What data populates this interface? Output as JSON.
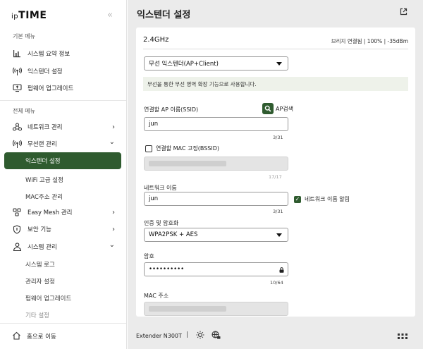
{
  "brand": {
    "logo_prefix": "ip",
    "logo_main": "TIME"
  },
  "sidebar": {
    "basic_section": "기본 메뉴",
    "basic_items": [
      {
        "label": "시스템 요약 정보",
        "icon": "bar-chart-icon"
      },
      {
        "label": "익스텐더 설정",
        "icon": "wifi-signal-icon"
      },
      {
        "label": "펌웨어 업그레이드",
        "icon": "monitor-upload-icon"
      }
    ],
    "full_section": "전체 메뉴",
    "full_items": [
      {
        "label": "네트워크 관리",
        "icon": "network-icon",
        "chevron": "›"
      },
      {
        "label": "무선랜 관리",
        "icon": "wifi-signal-icon",
        "chevron": "⌄"
      },
      {
        "label": "Easy Mesh 관리",
        "icon": "mesh-icon",
        "chevron": "›"
      },
      {
        "label": "보안 기능",
        "icon": "shield-icon",
        "chevron": "›"
      },
      {
        "label": "시스템 관리",
        "icon": "admin-icon",
        "chevron": "⌄"
      }
    ],
    "wireless_sub": [
      "익스텐더 설정",
      "WiFi 고급 설정",
      "MAC주소 관리"
    ],
    "system_sub": [
      "시스템 로그",
      "관리자 설정",
      "펌웨어 업그레이드",
      "기타 설정"
    ],
    "home": "홈으로 이동"
  },
  "main": {
    "title": "익스텐더 설정",
    "band": "2.4GHz",
    "status": "브리지 연결됨 | 100% | -35dBm",
    "mode_value": "무선 익스텐더(AP+Client)",
    "info": "무선을 통한 무선 영역 확장 기능으로 사용합니다.",
    "ssid_label": "연결할 AP 이름(SSID)",
    "ap_search": "AP검색",
    "ssid_value": "jun",
    "ssid_count": "3/31",
    "bssid_label": "연결할 MAC 고정(BSSID)",
    "bssid_checked": false,
    "bssid_count": "17/17",
    "netname_label": "네트워크 이름",
    "netname_value": "jun",
    "netname_count": "3/31",
    "notify_label": "네트워크 이름 알림",
    "notify_checked": true,
    "auth_label": "인증 및 암호화",
    "auth_value": "WPA2PSK + AES",
    "password_label": "암호",
    "password_value": "••••••••••",
    "password_count": "10/64",
    "mac_label": "MAC 주소"
  },
  "footer": {
    "model": "Extender N300T",
    "separator": "|"
  },
  "colors": {
    "accent": "#2f5b2f",
    "info_bg": "#eef2ea",
    "main_bg": "#ebebeb"
  }
}
